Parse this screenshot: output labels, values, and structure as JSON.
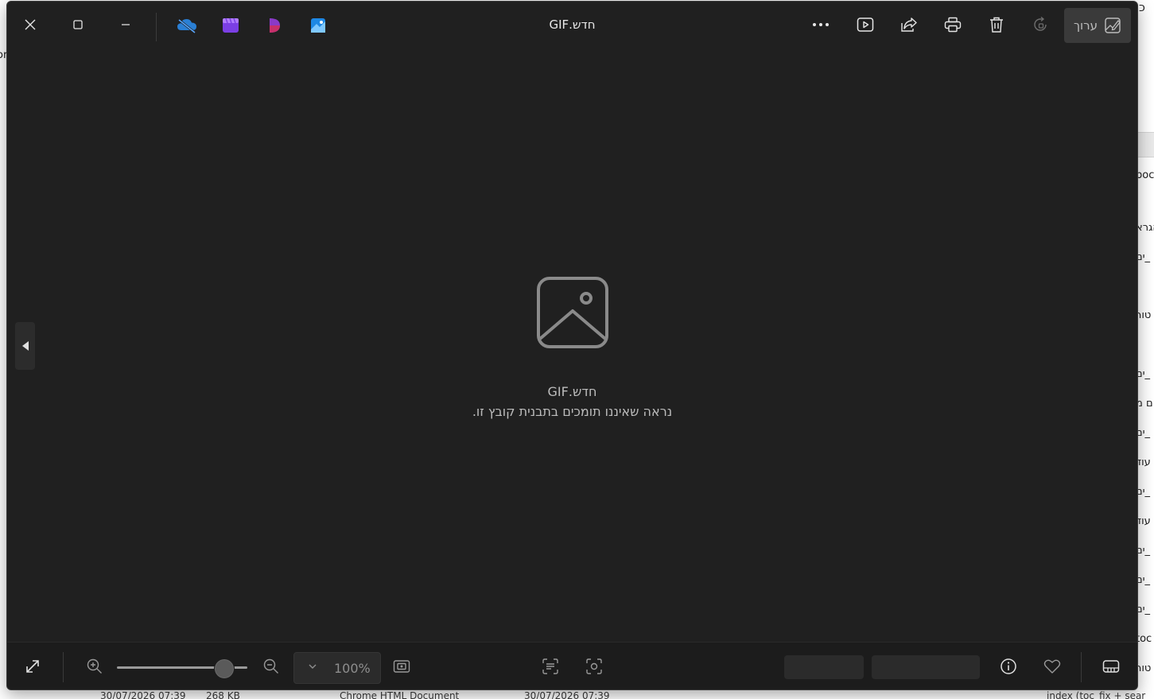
{
  "viewer": {
    "title": "חדש.GIF",
    "edit_label": "ערוך",
    "message_title": "חדש.GIF",
    "message_body": "נראה שאיננו תומכים בתבנית קובץ זו.",
    "zoom_value": "100%",
    "zoom_slider_fraction": 0.82,
    "accent": "#e6e6e6"
  },
  "titlebar_icons": [
    "close-icon",
    "maximize-icon",
    "minimize-icon",
    "onedrive-icon",
    "clipchamp-icon",
    "designer-icon",
    "photos-editor-icon",
    "more-icon",
    "slideshow-icon",
    "share-icon",
    "print-icon",
    "delete-icon",
    "rotate-icon",
    "edit-icon"
  ],
  "bottombar_icons": [
    "fullscreen-icon",
    "zoom-in-icon",
    "zoom-out-icon",
    "chevron-down-icon",
    "actual-size-icon",
    "text-recognition-icon",
    "visual-search-icon",
    "info-icon",
    "favorite-icon",
    "filmstrip-icon"
  ],
  "background": {
    "left_fragment": "or",
    "right_fragments": [
      "כ",
      "poc",
      "הגרא",
      "ים_",
      "טור",
      "ים_",
      "ם מ",
      "ים_",
      "עוד",
      "ים_",
      "עוד",
      "ים_",
      "ים_",
      "ים_",
      "toc",
      "טור"
    ],
    "bottom_row": [
      "30/07/2026 07:39",
      "268 KB",
      "Chrome HTML Document",
      "30/07/2026 07:39",
      "index (toc_fix + sear"
    ]
  }
}
